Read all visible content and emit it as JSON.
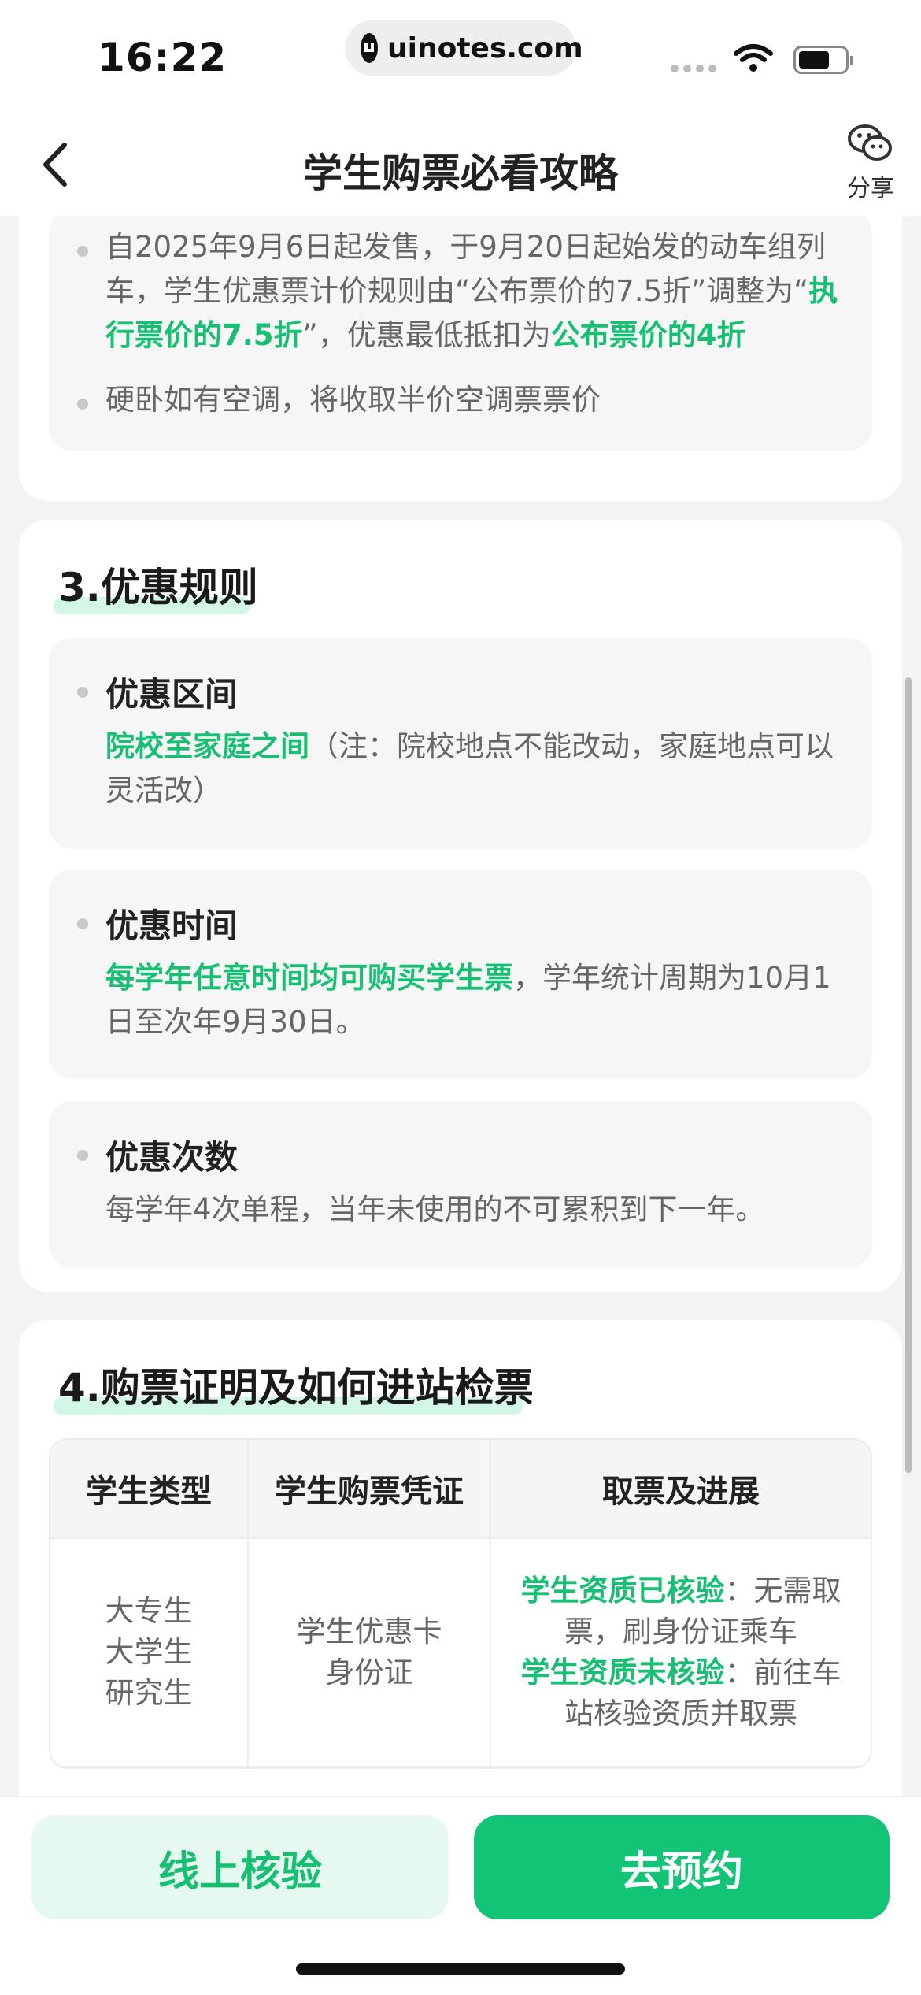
{
  "status_bar": {
    "time": "16:22",
    "url": "uinotes.com"
  },
  "nav": {
    "title": "学生购票必看攻略",
    "share_label": "分享"
  },
  "intro": {
    "bullet1": {
      "part1": "自2025年9月6日起发售，于9月20日起始发的动车组列车，学生优惠票计价规则由“公布票价的7.5折”调整为“",
      "highlight1": "执行票价的7.5折",
      "part2": "”，优惠最低抵扣为",
      "highlight2": "公布票价的4折"
    },
    "bullet2": "硬卧如有空调，将收取半价空调票票价"
  },
  "section3": {
    "number": "3.",
    "title": "优惠规则",
    "items": [
      {
        "title": "优惠区间",
        "highlight": "院校至家庭之间",
        "text": "（注：院校地点不能改动，家庭地点可以灵活改）"
      },
      {
        "title": "优惠时间",
        "highlight": "每学年任意时间均可购买学生票",
        "text": "，学年统计周期为10月1日至次年9月30日。"
      },
      {
        "title": "优惠次数",
        "highlight": "",
        "text": "每学年4次单程，当年未使用的不可累积到下一年。"
      }
    ]
  },
  "section4": {
    "number": "4.",
    "title": "购票证明及如何进站检票",
    "columns": [
      "学生类型",
      "学生购票凭证",
      "取票及进展"
    ],
    "row1": {
      "types": [
        "大专生",
        "大学生",
        "研究生"
      ],
      "credentials": [
        "学生优惠卡",
        "身份证"
      ],
      "verified_label": "学生资质已核验",
      "verified_text": "：无需取票，刷身份证乘车",
      "unverified_label": "学生资质未核验",
      "unverified_text": "：前往车站核验资质并取票"
    }
  },
  "bottom": {
    "verify_label": "线上核验",
    "book_label": "去预约"
  },
  "colors": {
    "accent": "#17bf73",
    "primary_button": "#12c475",
    "light_green": "#e6f9f0"
  }
}
